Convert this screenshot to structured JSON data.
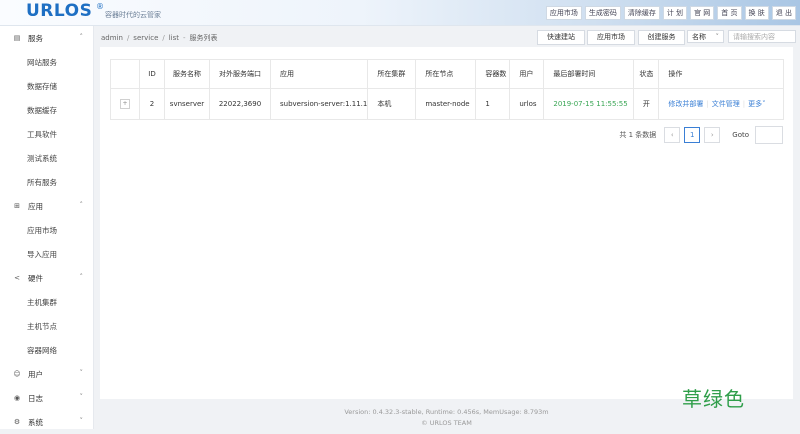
{
  "header": {
    "logo": "URLOS",
    "registered": "®",
    "slogan": "容器时代的云管家",
    "nav": [
      "应用市场",
      "生成密码",
      "清除缓存",
      "计 划",
      "官 网",
      "首 页",
      "换 肤",
      "退 出"
    ]
  },
  "sidebar": {
    "groups": [
      {
        "label": "服务",
        "icon": "server-icon",
        "items": [
          "网站服务",
          "数据存储",
          "数据缓存",
          "工具软件",
          "测试系统",
          "所有服务"
        ]
      },
      {
        "label": "应用",
        "icon": "grid-icon",
        "items": [
          "应用市场",
          "导入应用"
        ]
      },
      {
        "label": "硬件",
        "icon": "share-icon",
        "items": [
          "主机集群",
          "主机节点",
          "容器网络"
        ]
      },
      {
        "label": "用户",
        "icon": "user-icon",
        "items": []
      },
      {
        "label": "日志",
        "icon": "eye-icon",
        "items": []
      },
      {
        "label": "系统",
        "icon": "gear-icon",
        "items": []
      }
    ]
  },
  "breadcrumb": {
    "parts": [
      "admin",
      "service",
      "list",
      "服务列表"
    ]
  },
  "toolbar": {
    "quick_site": "快速建站",
    "app_market": "应用市场",
    "create_service": "创建服务",
    "search_field": "名称",
    "search_placeholder": "请输搜索内容"
  },
  "table": {
    "columns": [
      "",
      "ID",
      "服务名称",
      "对外服务端口",
      "应用",
      "所在集群",
      "所在节点",
      "容器数",
      "用户",
      "最后部署时间",
      "状态",
      "操作"
    ],
    "rows": [
      {
        "expand": "+",
        "id": "2",
        "name": "svnserver",
        "ports": "22022,3690",
        "app": "subversion-server:1.11.1",
        "cluster": "本机",
        "node": "master-node",
        "containers": "1",
        "user": "urlos",
        "deployed": "2019-07-15 11:55:55",
        "status": "开",
        "actions": {
          "edit": "修改并部署",
          "files": "文件管理",
          "more": "更多"
        }
      }
    ]
  },
  "pagination": {
    "total": "共 1 条数据",
    "prev": "‹",
    "current": "1",
    "next": "›",
    "goto": "Goto"
  },
  "footer": {
    "version": "Version: 0.4.32.3-stable,   Runtime: 0.456s,   MemUsage: 8.793m",
    "team": "© URLOS TEAM"
  },
  "watermark": "草绿色",
  "colors": {
    "brand": "#1e6fc3",
    "link": "#3a7fd5",
    "time": "#3aa655",
    "watermark": "#2f9e4a"
  }
}
